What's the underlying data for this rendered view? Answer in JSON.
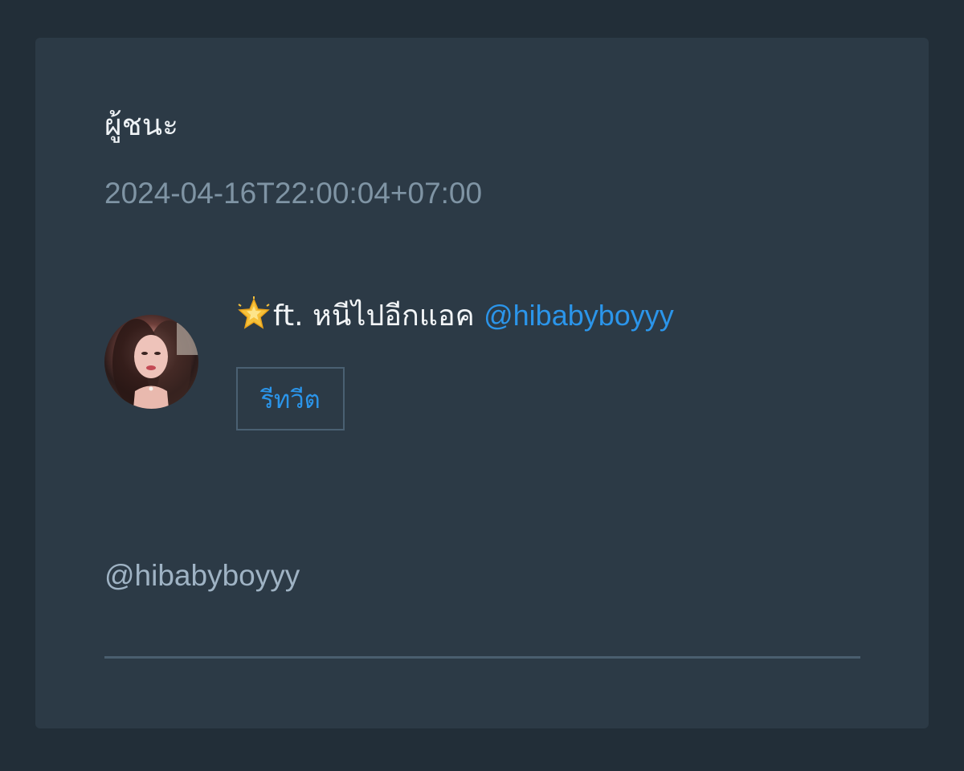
{
  "card": {
    "title": "ผู้ชนะ",
    "timestamp": "2024-04-16T22:00:04+07:00"
  },
  "tweet": {
    "icon": "glowing-star-icon",
    "text": "ft. หนีไปอีกแอค ",
    "mention": "@hibabyboyyy",
    "retweet_label": "รีทวีต"
  },
  "footer": {
    "handle": "@hibabyboyyy"
  },
  "colors": {
    "background": "#222e38",
    "card": "#2c3a46",
    "link": "#2b95ea",
    "muted": "#7f94a4"
  }
}
